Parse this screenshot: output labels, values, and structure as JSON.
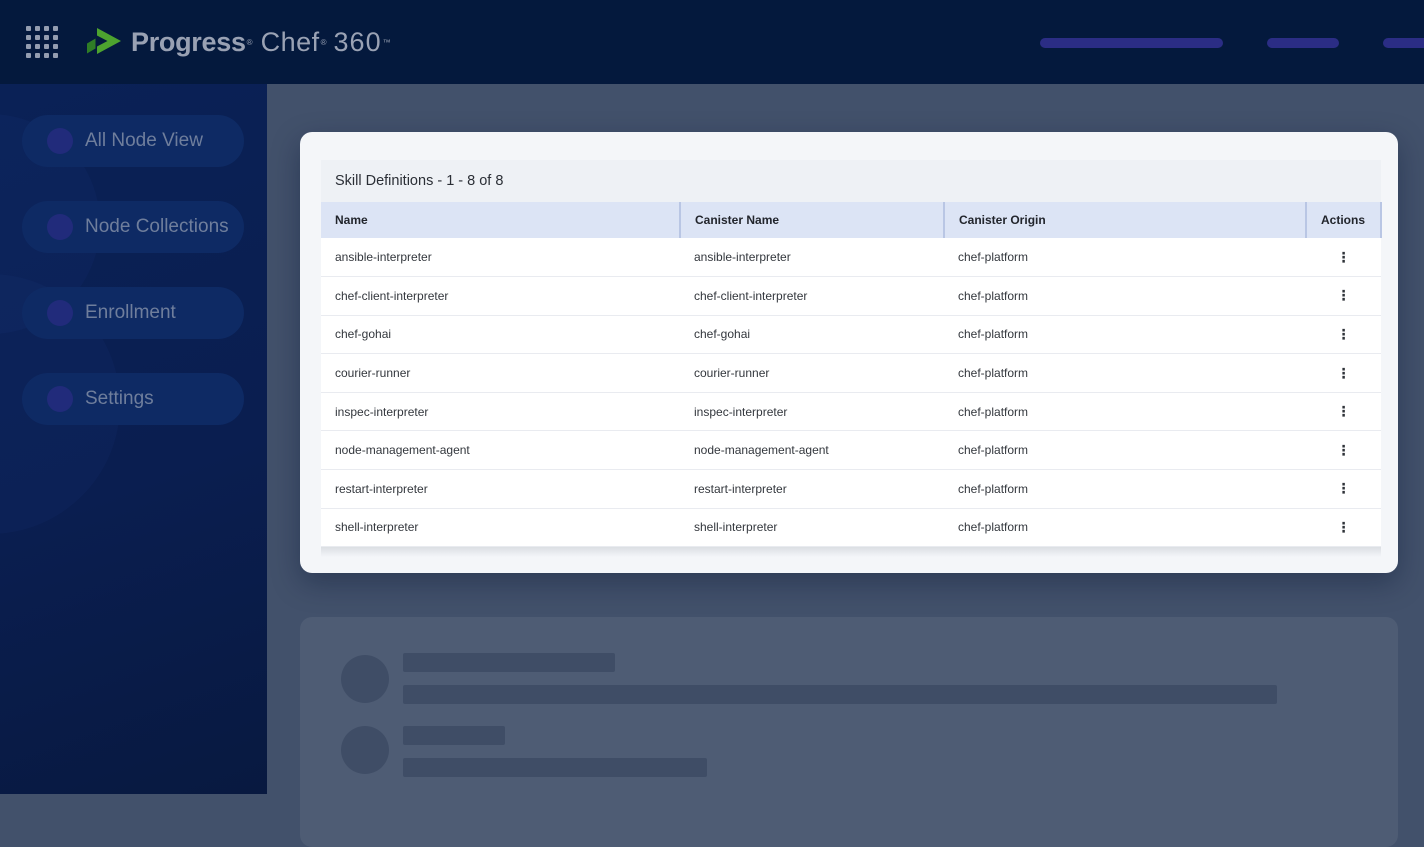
{
  "topbar": {
    "brand": "Progress",
    "brand_reg": "®",
    "product": "Chef",
    "product_reg": "®",
    "version": "360",
    "version_tm": "™",
    "icons": {
      "apps_grid": "apps-grid"
    },
    "loading_placeholders": 3
  },
  "sidebar": {
    "items": [
      {
        "label": "All Node View"
      },
      {
        "label": "Node Collections"
      },
      {
        "label": "Enrollment"
      },
      {
        "label": "Settings"
      }
    ]
  },
  "skill_table": {
    "title": "Skill Definitions - 1 - 8 of 8",
    "columns": [
      "Name",
      "Canister Name",
      "Canister Origin",
      "Actions"
    ],
    "rows": [
      {
        "name": "ansible-interpreter",
        "canister_name": "ansible-interpreter",
        "canister_origin": "chef-platform"
      },
      {
        "name": "chef-client-interpreter",
        "canister_name": "chef-client-interpreter",
        "canister_origin": "chef-platform"
      },
      {
        "name": "chef-gohai",
        "canister_name": "chef-gohai",
        "canister_origin": "chef-platform"
      },
      {
        "name": "courier-runner",
        "canister_name": "courier-runner",
        "canister_origin": "chef-platform"
      },
      {
        "name": "inspec-interpreter",
        "canister_name": "inspec-interpreter",
        "canister_origin": "chef-platform"
      },
      {
        "name": "node-management-agent",
        "canister_name": "node-management-agent",
        "canister_origin": "chef-platform"
      },
      {
        "name": "restart-interpreter",
        "canister_name": "restart-interpreter",
        "canister_origin": "chef-platform"
      },
      {
        "name": "shell-interpreter",
        "canister_name": "shell-interpreter",
        "canister_origin": "chef-platform"
      }
    ]
  },
  "icons": {
    "kebab": "⋮"
  },
  "colors": {
    "topbar_bg": "#04193D",
    "sidebar_bg": "#0A2156",
    "nav_pill_bg": "#0E2A64",
    "nav_dot": "#212B7B",
    "nav_text": "#6F7E9C",
    "main_bg": "#42516B",
    "card_bg": "#F4F6F9",
    "table_header_bg": "#DCE4F5",
    "skeleton_card_bg": "#4E5C74",
    "skeleton_shape": "#3F4D66",
    "topbar_skeleton": "#2B2D85",
    "logo_green_dark": "#2F7D26",
    "logo_green": "#4DA32F",
    "logo_text": "#99A1B3"
  }
}
